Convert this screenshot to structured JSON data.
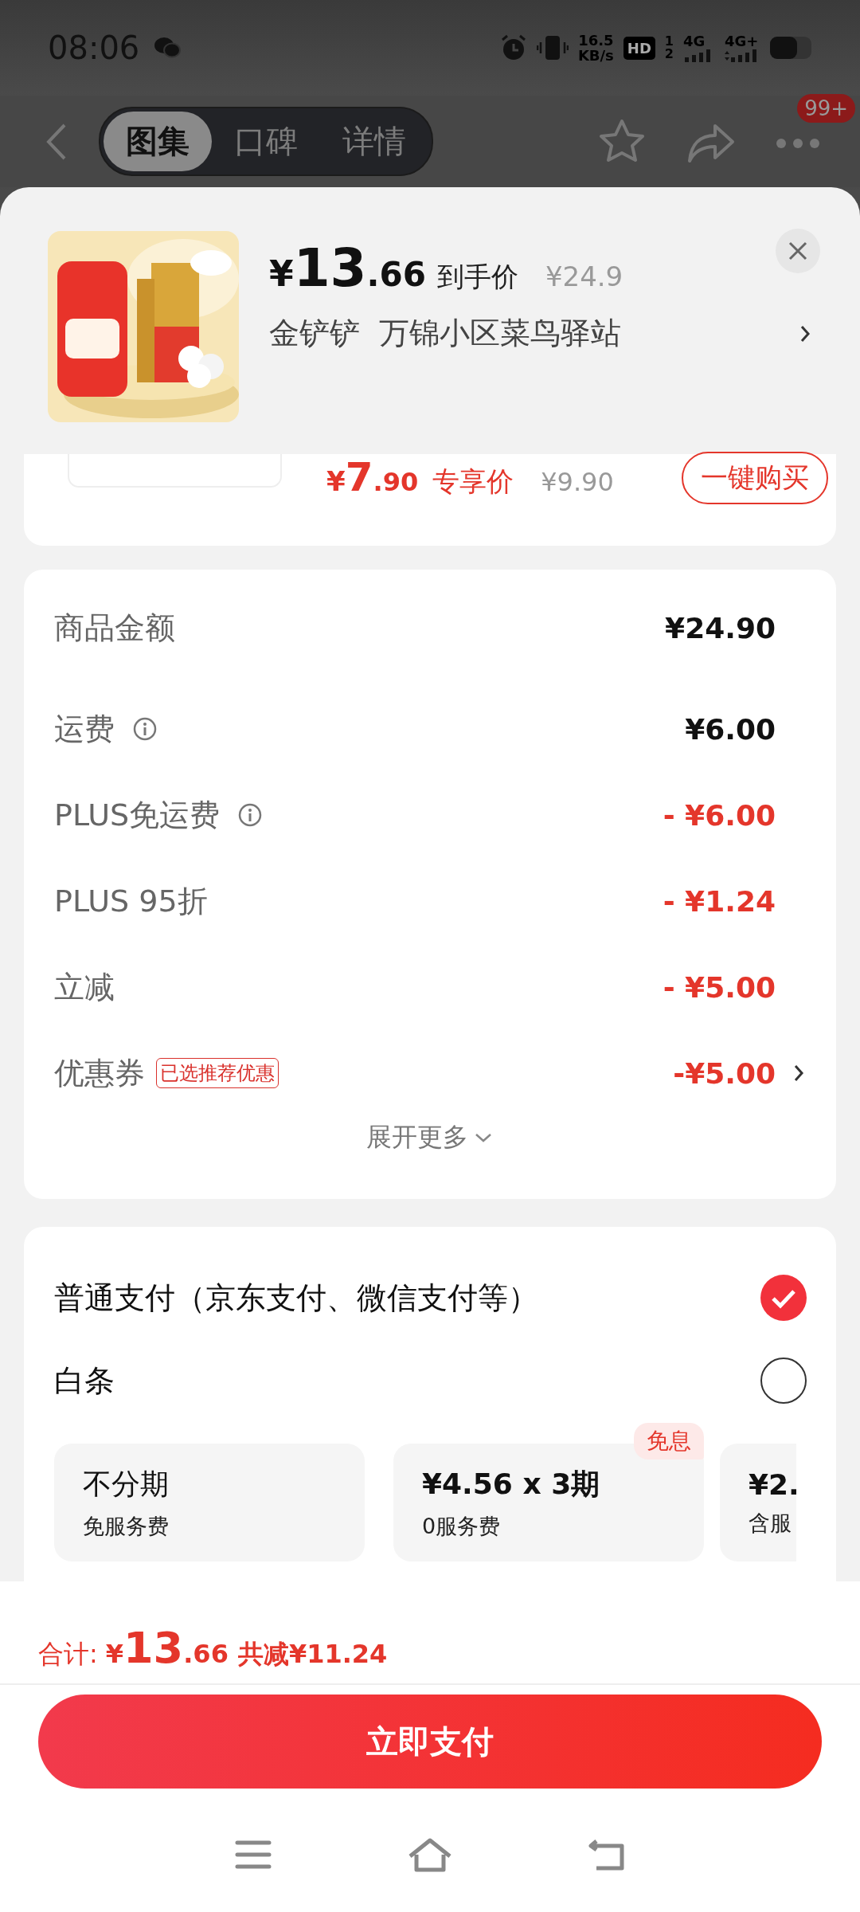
{
  "status_bar": {
    "time": "08:06",
    "speed": "16.5",
    "speed_unit": "KB/s",
    "hd": "HD",
    "hd_slots": [
      "1",
      "2"
    ],
    "network_1": "4G",
    "network_2": "4G+"
  },
  "nav": {
    "tabs": [
      {
        "label": "图集",
        "selected": true
      },
      {
        "label": "口碑",
        "selected": false
      },
      {
        "label": "详情",
        "selected": false
      }
    ],
    "badge": "99+"
  },
  "product": {
    "currency": "¥",
    "price_integer": "13",
    "price_decimal": ".66",
    "price_label": "到手价",
    "original_price": "¥24.9",
    "shop": "金铲铲  万锦小区菜鸟驿站"
  },
  "offer": {
    "currency": "¥",
    "price_integer": "7",
    "price_decimal": ".90",
    "price_label": "专享价",
    "original_price": "¥9.90",
    "button": "一键购买"
  },
  "breakdown": [
    {
      "label": "商品金额",
      "info": false,
      "amount": "¥24.90",
      "discount": false,
      "arrow": false
    },
    {
      "label": "运费",
      "info": true,
      "amount": "¥6.00",
      "discount": false,
      "arrow": false
    },
    {
      "label": "PLUS免运费",
      "info": true,
      "amount": "- ¥6.00",
      "discount": true,
      "arrow": false
    },
    {
      "label": "PLUS 95折",
      "info": false,
      "amount": "- ¥1.24",
      "discount": true,
      "arrow": false
    },
    {
      "label": "立减",
      "info": false,
      "amount": "- ¥5.00",
      "discount": true,
      "arrow": false
    },
    {
      "label": "优惠券",
      "tag": "已选推荐优惠",
      "info": false,
      "amount": "-¥5.00",
      "discount": true,
      "arrow": true
    }
  ],
  "expand": "展开更多",
  "payment_methods": [
    {
      "label": "普通支付（京东支付、微信支付等）",
      "selected": true
    },
    {
      "label": "白条",
      "selected": false
    }
  ],
  "installments": [
    {
      "title": "不分期",
      "subtitle": "免服务费"
    },
    {
      "title": "¥4.56 x 3期",
      "subtitle": "0服务费",
      "badge": "免息"
    },
    {
      "title": "¥2.",
      "subtitle": "含服",
      "cut": true
    }
  ],
  "total": {
    "label": "合计:",
    "currency": "¥",
    "integer": "13",
    "decimal": ".66",
    "saving": "共减¥11.24"
  },
  "pay_button": "立即支付"
}
